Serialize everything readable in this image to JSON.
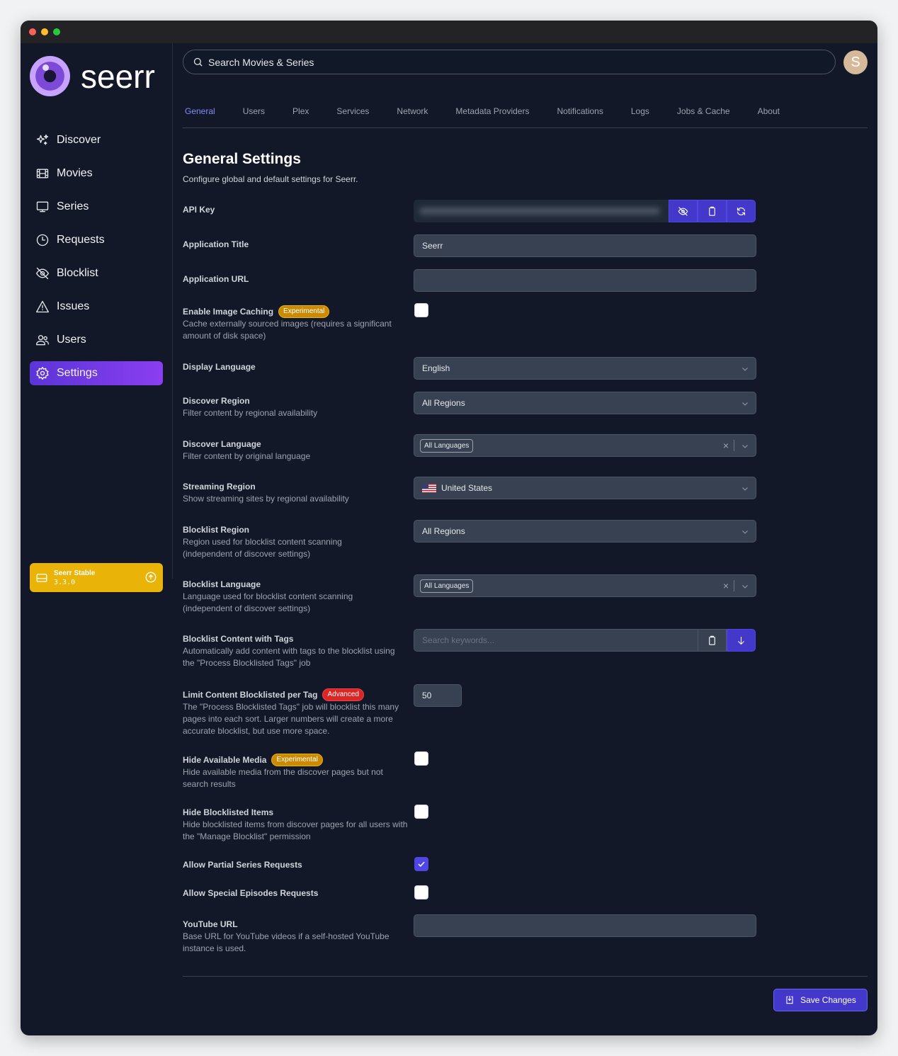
{
  "app": {
    "logo_text": "seerr"
  },
  "sidebar": {
    "items": [
      {
        "label": "Discover",
        "icon": "sparkles-icon"
      },
      {
        "label": "Movies",
        "icon": "film-icon"
      },
      {
        "label": "Series",
        "icon": "tv-icon"
      },
      {
        "label": "Requests",
        "icon": "clock-icon"
      },
      {
        "label": "Blocklist",
        "icon": "eye-slash-icon"
      },
      {
        "label": "Issues",
        "icon": "warning-icon"
      },
      {
        "label": "Users",
        "icon": "users-icon"
      },
      {
        "label": "Settings",
        "icon": "gear-icon",
        "active": true
      }
    ],
    "version": {
      "name": "Seerr Stable",
      "number": "3.3.0"
    }
  },
  "search": {
    "placeholder": "Search Movies & Series"
  },
  "user": {
    "avatar_initial": "S"
  },
  "tabs": [
    "General",
    "Users",
    "Plex",
    "Services",
    "Network",
    "Metadata Providers",
    "Notifications",
    "Logs",
    "Jobs & Cache",
    "About"
  ],
  "active_tab": "General",
  "page": {
    "title": "General Settings",
    "subtitle": "Configure global and default settings for Seerr."
  },
  "settings": {
    "api_key": {
      "label": "API Key"
    },
    "app_title": {
      "label": "Application Title",
      "value": "Seerr"
    },
    "app_url": {
      "label": "Application URL",
      "value": ""
    },
    "image_caching": {
      "label": "Enable Image Caching",
      "badge": "Experimental",
      "desc": "Cache externally sourced images (requires a significant amount of disk space)",
      "checked": false
    },
    "display_language": {
      "label": "Display Language",
      "value": "English"
    },
    "discover_region": {
      "label": "Discover Region",
      "desc": "Filter content by regional availability",
      "value": "All Regions"
    },
    "discover_language": {
      "label": "Discover Language",
      "desc": "Filter content by original language",
      "chip": "All Languages"
    },
    "streaming_region": {
      "label": "Streaming Region",
      "desc": "Show streaming sites by regional availability",
      "value": "United States"
    },
    "blocklist_region": {
      "label": "Blocklist Region",
      "desc": "Region used for blocklist content scanning (independent of discover settings)",
      "value": "All Regions"
    },
    "blocklist_language": {
      "label": "Blocklist Language",
      "desc": "Language used for blocklist content scanning (independent of discover settings)",
      "chip": "All Languages"
    },
    "blocklist_tags": {
      "label": "Blocklist Content with Tags",
      "desc": "Automatically add content with tags to the blocklist using the \"Process Blocklisted Tags\" job",
      "placeholder": "Search keywords..."
    },
    "limit_per_tag": {
      "label": "Limit Content Blocklisted per Tag",
      "badge": "Advanced",
      "desc": "The \"Process Blocklisted Tags\" job will blocklist this many pages into each sort. Larger numbers will create a more accurate blocklist, but use more space.",
      "value": "50"
    },
    "hide_available": {
      "label": "Hide Available Media",
      "badge": "Experimental",
      "desc": "Hide available media from the discover pages but not search results",
      "checked": false
    },
    "hide_blocklisted": {
      "label": "Hide Blocklisted Items",
      "desc": "Hide blocklisted items from discover pages for all users with the \"Manage Blocklist\" permission",
      "checked": false
    },
    "partial_series": {
      "label": "Allow Partial Series Requests",
      "checked": true
    },
    "special_episodes": {
      "label": "Allow Special Episodes Requests",
      "checked": false
    },
    "youtube_url": {
      "label": "YouTube URL",
      "desc": "Base URL for YouTube videos if a self-hosted YouTube instance is used.",
      "value": ""
    }
  },
  "actions": {
    "save_label": "Save Changes"
  },
  "colors": {
    "accent": "#4f46e5",
    "active_nav": "#7c3aed",
    "version_badge": "#eab308",
    "experimental": "#ca8a04",
    "advanced": "#dc2626"
  }
}
